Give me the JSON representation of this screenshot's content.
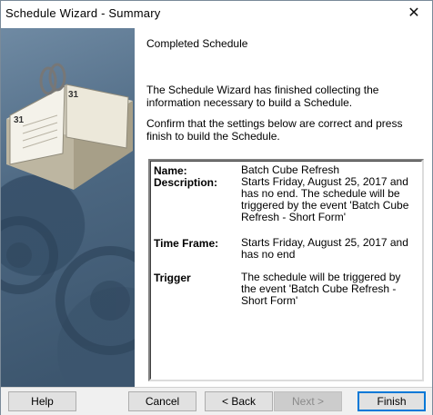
{
  "window": {
    "title": "Schedule Wizard - Summary",
    "close_glyph": "✕"
  },
  "graphic": {
    "icon": "desk-calendar-gears-illustration",
    "calendar_day": "31",
    "calendar_day_small": "31"
  },
  "content": {
    "heading": "Completed Schedule",
    "para1": "The Schedule Wizard has finished collecting the information necessary to build a Schedule.",
    "para2": "Confirm that the settings below are correct and press finish to build the Schedule."
  },
  "summary": {
    "name_label": "Name:",
    "name_value": "Batch Cube Refresh",
    "description_label": "Description:",
    "description_value": "Starts Friday, August 25, 2017 and has no end. The schedule will be triggered by the event 'Batch Cube Refresh - Short Form'",
    "timeframe_label": "Time Frame:",
    "timeframe_value": "Starts Friday, August 25, 2017 and has no end",
    "trigger_label": "Trigger",
    "trigger_value": "The schedule will be triggered by the event 'Batch Cube Refresh - Short Form'"
  },
  "buttons": {
    "help": "Help",
    "cancel": "Cancel",
    "back": "< Back",
    "next": "Next >",
    "finish": "Finish"
  }
}
